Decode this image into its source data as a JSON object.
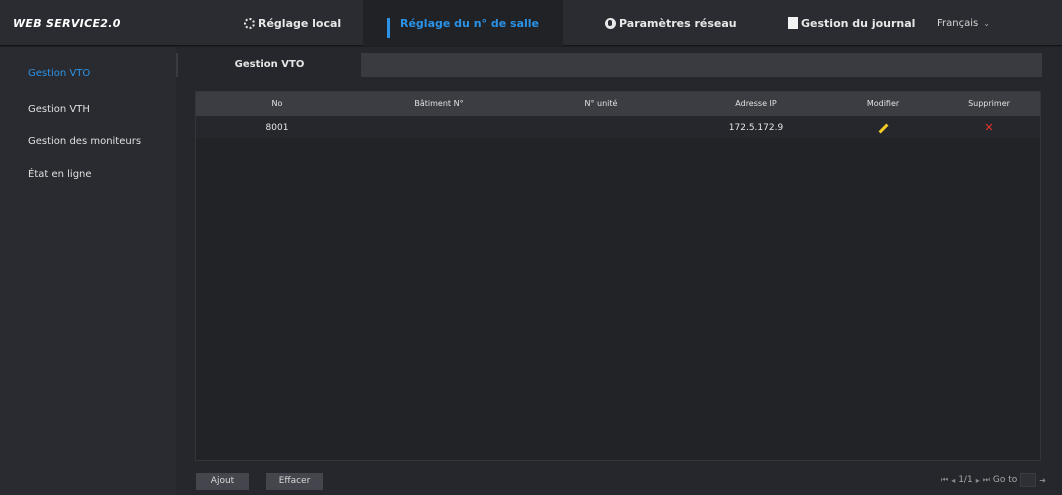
{
  "header": {
    "logo": "WEB SERVICE2.0",
    "nav": {
      "local": "Réglage local",
      "room": "Réglage du n° de salle",
      "network": "Paramètres réseau",
      "log": "Gestion du journal",
      "language": "Français"
    }
  },
  "sidebar": {
    "items": [
      {
        "label": "Gestion VTO"
      },
      {
        "label": "Gestion VTH"
      },
      {
        "label": "Gestion des moniteurs"
      },
      {
        "label": "État en ligne"
      }
    ]
  },
  "main": {
    "tab_label": "Gestion VTO",
    "table": {
      "headers": [
        "No",
        "Bâtiment N°",
        "N° unité",
        "Adresse IP",
        "Modifier",
        "Supprimer"
      ],
      "rows": [
        {
          "no": "8001",
          "building": "",
          "unit": "",
          "ip": "172.5.172.9"
        }
      ]
    },
    "buttons": {
      "add": "Ajout",
      "clear": "Effacer"
    },
    "pagination": {
      "first": "⏮",
      "prev": "◂",
      "page": "1/1",
      "next": "▸",
      "last": "⏭",
      "goto_label": "Go to",
      "go": "➜"
    }
  },
  "colors": {
    "accent": "#2a93e8",
    "edit_icon": "#f2cc25",
    "delete_icon": "#e8332f"
  }
}
